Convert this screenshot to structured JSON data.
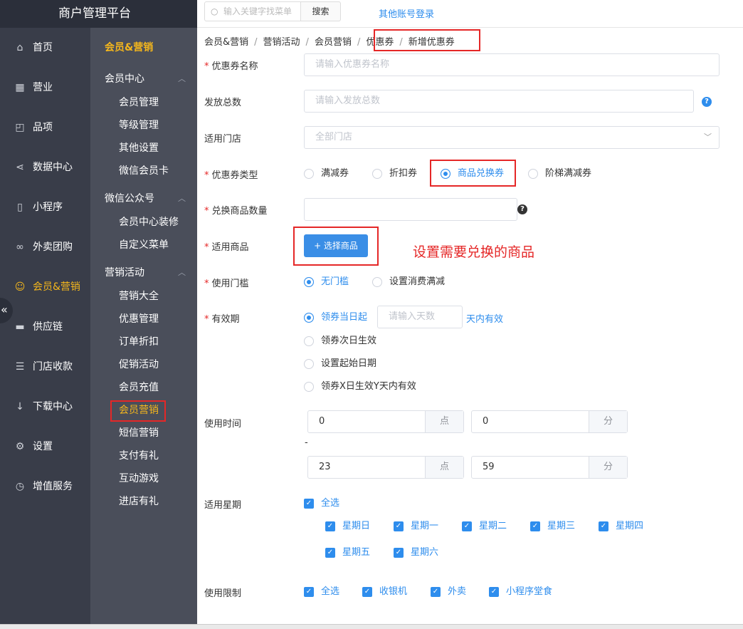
{
  "app": {
    "title": "商户管理平台"
  },
  "topbar": {
    "search_placeholder": "输入关键字找菜单",
    "search_button": "搜索",
    "other_login": "其他账号登录"
  },
  "nav_main": [
    {
      "label": "首页",
      "icon": "home-icon"
    },
    {
      "label": "营业",
      "icon": "calendar-icon"
    },
    {
      "label": "品项",
      "icon": "bag-icon"
    },
    {
      "label": "数据中心",
      "icon": "share-icon"
    },
    {
      "label": "小程序",
      "icon": "mobile-icon"
    },
    {
      "label": "外卖团购",
      "icon": "bike-icon"
    },
    {
      "label": "会员&营销",
      "icon": "user-icon",
      "active": true
    },
    {
      "label": "供应链",
      "icon": "truck-icon"
    },
    {
      "label": "门店收款",
      "icon": "database-icon"
    },
    {
      "label": "下载中心",
      "icon": "download-icon"
    },
    {
      "label": "设置",
      "icon": "gear-icon"
    },
    {
      "label": "增值服务",
      "icon": "alarm-icon"
    }
  ],
  "subnav": {
    "title": "会员&营销",
    "groups": [
      {
        "title": "会员中心",
        "items": [
          "会员管理",
          "等级管理",
          "其他设置",
          "微信会员卡"
        ]
      },
      {
        "title": "微信公众号",
        "items": [
          "会员中心装修",
          "自定义菜单"
        ]
      },
      {
        "title": "营销活动",
        "items": [
          "营销大全",
          "优惠管理",
          "订单折扣",
          "促销活动",
          "会员充值",
          "会员营销",
          "短信营销",
          "支付有礼",
          "互动游戏",
          "进店有礼"
        ]
      }
    ]
  },
  "breadcrumb": [
    "会员&营销",
    "营销活动",
    "会员营销",
    "优惠券",
    "新增优惠券"
  ],
  "form": {
    "name_label": "优惠券名称",
    "name_placeholder": "请输入优惠券名称",
    "total_label": "发放总数",
    "total_placeholder": "请输入发放总数",
    "store_label": "适用门店",
    "store_value": "全部门店",
    "type_label": "优惠券类型",
    "type_options": [
      "满减券",
      "折扣券",
      "商品兑换券",
      "阶梯满减券"
    ],
    "qty_label": "兑换商品数量",
    "goods_label": "适用商品",
    "goods_button": "+ 选择商品",
    "annotation": "设置需要兑换的商品",
    "threshold_label": "使用门槛",
    "threshold_options": [
      "无门槛",
      "设置消费满减"
    ],
    "validity_label": "有效期",
    "validity_options": [
      "领券当日起",
      "领券次日生效",
      "设置起始日期",
      "领券X日生效Y天内有效"
    ],
    "days_placeholder": "请输入天数",
    "days_suffix": "天内有效",
    "time_label": "使用时间",
    "time_sep": "-",
    "start_hour": "0",
    "start_min": "0",
    "end_hour": "23",
    "end_min": "59",
    "hour_unit": "点",
    "min_unit": "分",
    "week_label": "适用星期",
    "week_all": "全选",
    "week_days": [
      "星期日",
      "星期一",
      "星期二",
      "星期三",
      "星期四",
      "星期五",
      "星期六"
    ],
    "limit_label": "使用限制",
    "limit_options": [
      "全选",
      "收银机",
      "外卖",
      "小程序堂食"
    ]
  }
}
